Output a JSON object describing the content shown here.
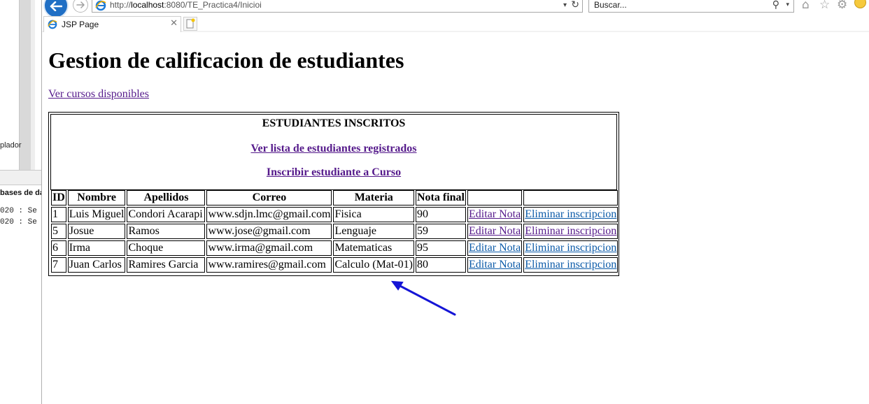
{
  "background_app": {
    "label1": "plador",
    "header": "bases de da",
    "console": [
      "020 : Se",
      "020 : Se"
    ]
  },
  "browser": {
    "url_host": "localhost",
    "url_prefix": "http://",
    "url_path": ":8080/TE_Practica4/Inicioi",
    "search_placeholder": "Buscar...",
    "tab_title": "JSP Page"
  },
  "page": {
    "title": "Gestion de calificacion de estudiantes",
    "courses_link": "Ver cursos disponibles",
    "panel": {
      "title": "ESTUDIANTES INSCRITOS",
      "registered_link": "Ver lista de estudiantes registrados",
      "enroll_link": "Inscribir estudiante a Curso"
    },
    "table": {
      "headers": [
        "ID",
        "Nombre",
        "Apellidos",
        "Correo",
        "Materia",
        "Nota final",
        "",
        ""
      ],
      "rows": [
        {
          "id": "1",
          "nombre": "Luis Miguel",
          "apellidos": "Condori Acarapi",
          "correo": "www.sdjn.lmc@gmail.com",
          "materia": "Fisica",
          "nota": "90",
          "edit": "Editar Nota",
          "delete": "Eliminar inscripcion"
        },
        {
          "id": "5",
          "nombre": "Josue",
          "apellidos": "Ramos",
          "correo": "www.jose@gmail.com",
          "materia": "Lenguaje",
          "nota": "59",
          "edit": "Editar Nota",
          "delete": "Eliminar inscripcion"
        },
        {
          "id": "6",
          "nombre": "Irma",
          "apellidos": "Choque",
          "correo": "www.irma@gmail.com",
          "materia": "Matematicas",
          "nota": "95",
          "edit": "Editar Nota",
          "delete": "Eliminar inscripcion"
        },
        {
          "id": "7",
          "nombre": "Juan Carlos",
          "apellidos": "Ramires Garcia",
          "correo": "www.ramires@gmail.com",
          "materia": "Calculo (Mat-01)",
          "nota": "80",
          "edit": "Editar Nota",
          "delete": "Eliminar inscripcion"
        }
      ]
    }
  },
  "colors": {
    "visited_link": "#551a8b",
    "link": "#0b5aa8",
    "annotation_arrow": "#1515d6"
  }
}
